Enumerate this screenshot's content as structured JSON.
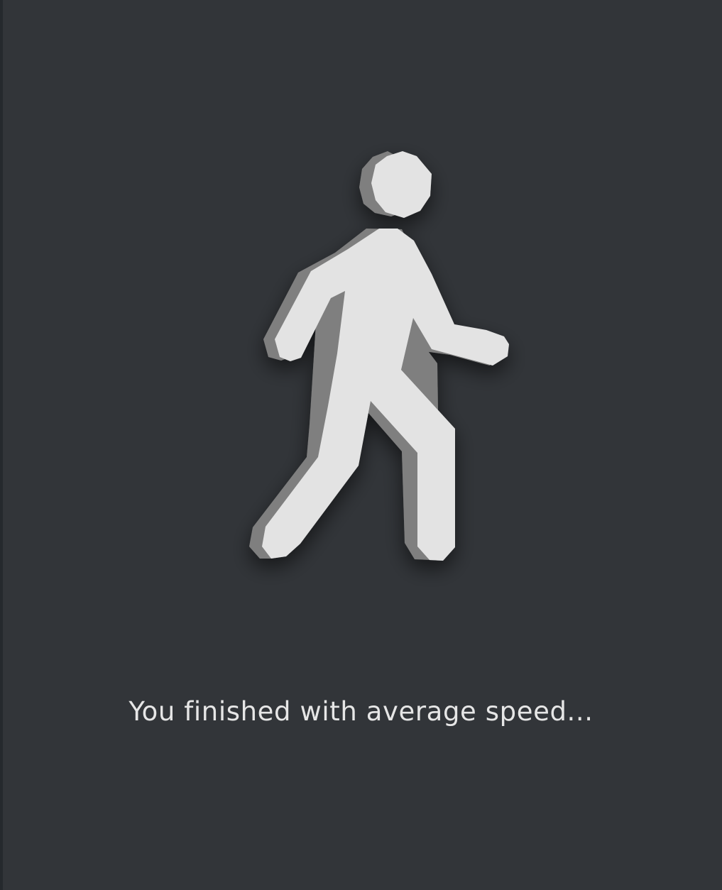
{
  "result": {
    "message": "You finished with average speed..."
  },
  "icon": {
    "name": "walking-person-icon",
    "fill_color": "#e3e3e3",
    "edge_color": "#7f7f7f",
    "background_color": "#323539"
  }
}
